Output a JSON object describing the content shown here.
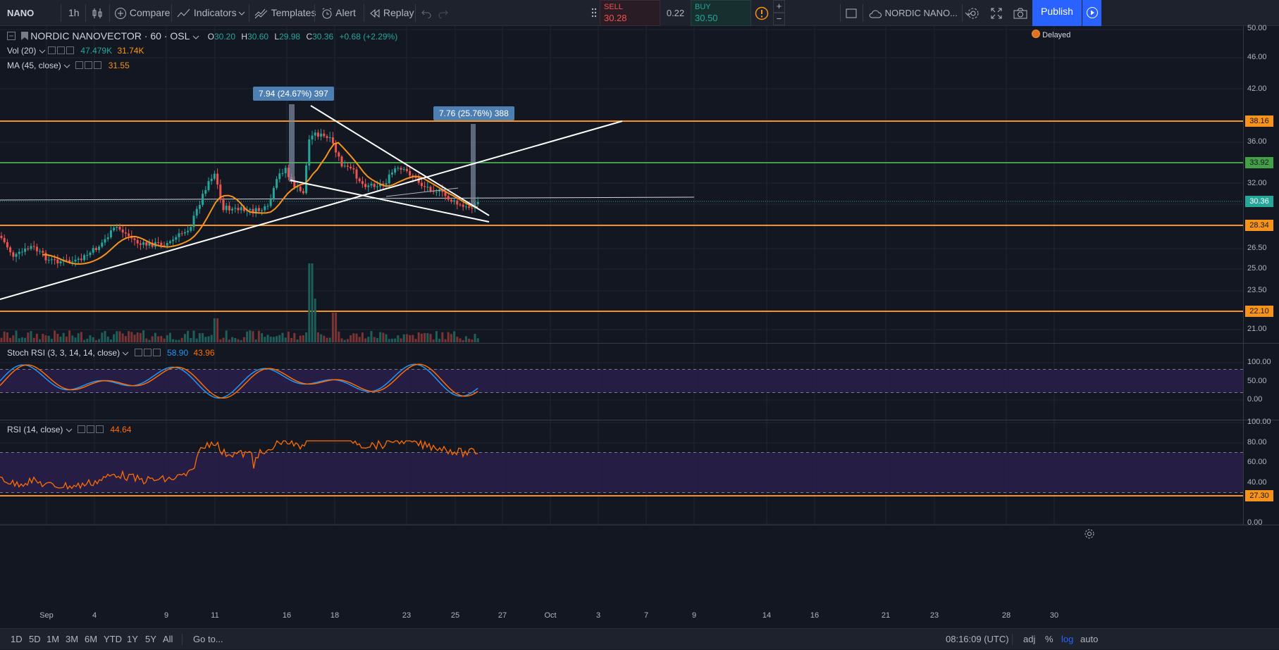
{
  "toolbar": {
    "symbol": "NANO",
    "interval": "1h",
    "compare": "Compare",
    "indicators": "Indicators",
    "templates": "Templates",
    "alert": "Alert",
    "replay": "Replay",
    "publish": "Publish",
    "layout_name": "NORDIC NANO..."
  },
  "trade": {
    "sell_label": "SELL",
    "sell_price": "30.28",
    "spread": "0.22",
    "buy_label": "BUY",
    "buy_price": "30.50",
    "plus": "+",
    "minus": "−",
    "colors": {
      "sell": "#ef5350",
      "buy": "#26a69a"
    }
  },
  "main_legend": {
    "title": "NORDIC NANOVECTOR · 60 · OSL",
    "o_label": "O",
    "o_value": "30.20",
    "h_label": "H",
    "h_value": "30.60",
    "l_label": "L",
    "l_value": "29.98",
    "c_label": "C",
    "c_value": "30.36",
    "change": "+0.68 (+2.29%)",
    "vol_label": "Vol (20)",
    "vol_value1": "47.479K",
    "vol_value2": "31.74K",
    "ma_label": "MA (45, close)",
    "ma_value": "31.55",
    "delayed": "Delayed"
  },
  "stoch_legend": {
    "label": "Stoch RSI (3, 3, 14, 14, close)",
    "k": "58.90",
    "d": "43.96"
  },
  "rsi_legend": {
    "label": "RSI (14, close)",
    "value": "44.64"
  },
  "measure_tips": [
    "7.94 (24.67%) 397",
    "7.76 (25.76%) 388"
  ],
  "price_axis": [
    "50.00",
    "46.00",
    "42.00",
    "36.00",
    "32.00",
    "26.50",
    "25.00",
    "23.50",
    "21.00"
  ],
  "price_tags": [
    {
      "text": "38.16",
      "color": "#f7931a"
    },
    {
      "text": "33.92",
      "color": "#43a047"
    },
    {
      "text": "30.36",
      "color": "#26a69a"
    },
    {
      "text": "28.34",
      "color": "#f7931a"
    },
    {
      "text": "22.10",
      "color": "#f7931a"
    }
  ],
  "stoch_axis": [
    "100.00",
    "50.00",
    "0.00"
  ],
  "rsi_axis": [
    "100.00",
    "80.00",
    "60.00",
    "40.00",
    "0.00"
  ],
  "rsi_tag": {
    "text": "27.30",
    "color": "#f7931a"
  },
  "date_axis": [
    "Sep",
    "4",
    "9",
    "11",
    "16",
    "18",
    "23",
    "25",
    "27",
    "Oct",
    "3",
    "7",
    "9",
    "14",
    "16",
    "21",
    "23",
    "28",
    "30"
  ],
  "bottom": {
    "ranges": [
      "1D",
      "5D",
      "1M",
      "3M",
      "6M",
      "YTD",
      "1Y",
      "5Y",
      "All"
    ],
    "goto": "Go to...",
    "time": "08:16:09 (UTC)",
    "adj": "adj",
    "pct": "%",
    "log": "log",
    "auto": "auto"
  },
  "colors": {
    "background": "#131722",
    "up": "#26a69a",
    "down": "#ef5350",
    "ma": "#f7931a",
    "stoch_k": "#2196f3",
    "stoch_d": "#ff6d00",
    "rsi": "#ff6d00",
    "support": "#f7931a",
    "resistance_green": "#43a047",
    "accent": "#2962ff"
  }
}
